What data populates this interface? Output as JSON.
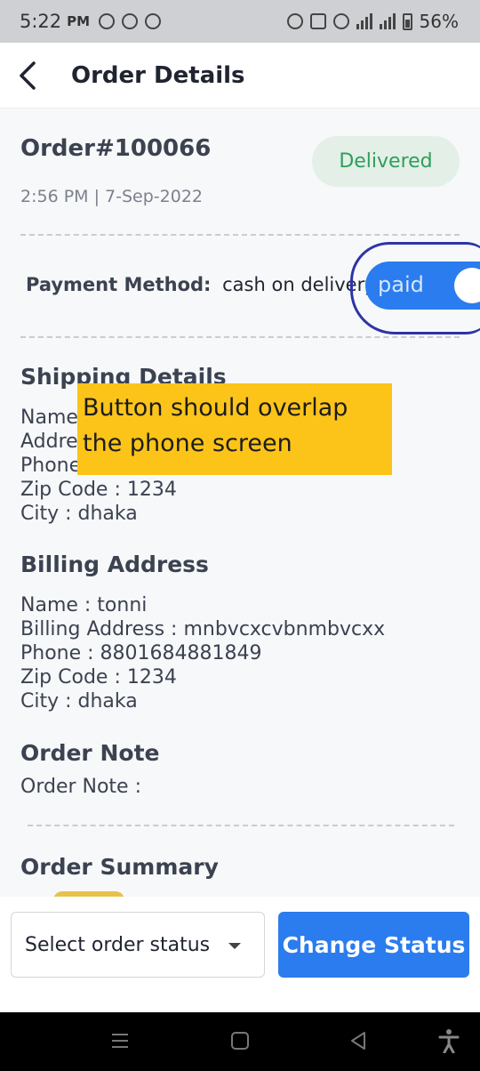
{
  "status_bar": {
    "time": "5:22",
    "ampm": "PM",
    "battery": "56%"
  },
  "header": {
    "title": "Order Details"
  },
  "order": {
    "id": "Order#100066",
    "status": "Delivered",
    "datetime": "2:56 PM | 7-Sep-2022",
    "status_color": "#2f9e5b"
  },
  "payment": {
    "label": "Payment Method:",
    "value": "cash on delivery",
    "toggle_label": "paid",
    "toggle_on": true
  },
  "annotation": {
    "text": "Button should overlap the phone screen"
  },
  "shipping": {
    "title": "Shipping Details",
    "name_partial": "Name",
    "address_partial": "Addre",
    "phone_partial": "Phone",
    "zip": "Zip Code : 1234",
    "city": "City : dhaka"
  },
  "billing": {
    "title": "Billing Address",
    "name": "Name : tonni",
    "address": "Billing Address : mnbvcxcvbnmbvcxx",
    "phone": "Phone : 8801684881849",
    "zip": "Zip Code : 1234",
    "city": "City : dhaka"
  },
  "note": {
    "title": "Order Note",
    "line": "Order Note :"
  },
  "summary": {
    "title": "Order Summary"
  },
  "bottom": {
    "select_placeholder": "Select order status",
    "change_button": "Change Status"
  },
  "colors": {
    "accent": "#2b7cee",
    "annotation_bg": "#fcc419",
    "annotation_stroke": "#2e34a6"
  }
}
